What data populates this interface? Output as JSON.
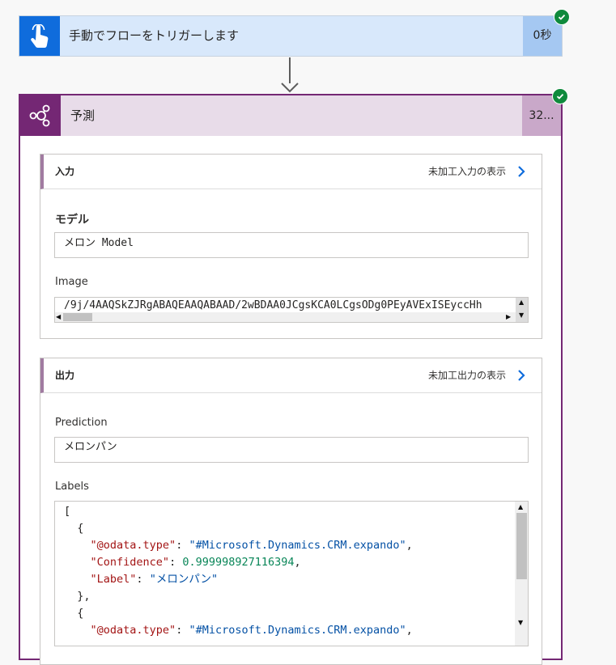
{
  "trigger": {
    "title": "手動でフローをトリガーします",
    "duration": "0秒",
    "icon": "hand-pointer-icon",
    "status": "succeeded"
  },
  "action": {
    "title": "予測",
    "duration": "32...",
    "icon": "ai-builder-icon",
    "status": "succeeded",
    "inputs": {
      "title": "入力",
      "raw_link": "未加工入力の表示",
      "model_label": "モデル",
      "model_value": "メロン Model",
      "image_label": "Image",
      "image_value": "/9j/4AAQSkZJRgABAQEAAQABAAD/2wBDAA0JCgsKCA0LCgsODg0PEyAVExISEyccHh"
    },
    "outputs": {
      "title": "出力",
      "raw_link": "未加工出力の表示",
      "prediction_label": "Prediction",
      "prediction_value": "メロンパン",
      "labels_label": "Labels",
      "labels_json": {
        "open_bracket": "[",
        "open_brace": "{",
        "k1": "\"@odata.type\"",
        "v1": "\"#Microsoft.Dynamics.CRM.expando\"",
        "k2": "\"Confidence\"",
        "v2": "0.999998927116394",
        "k3": "\"Label\"",
        "v3": "\"メロンパン\"",
        "close_brace": "},",
        "open_brace2": "{",
        "k4": "\"@odata.type\"",
        "v4": "\"#Microsoft.Dynamics.CRM.expando\""
      }
    }
  },
  "colors": {
    "trigger_accent": "#0f6cdc",
    "trigger_header": "#d8e8fb",
    "action_accent": "#742774",
    "action_header": "#e8dce9",
    "success": "#0f8a3c",
    "link_chevron": "#0f6cdc"
  }
}
